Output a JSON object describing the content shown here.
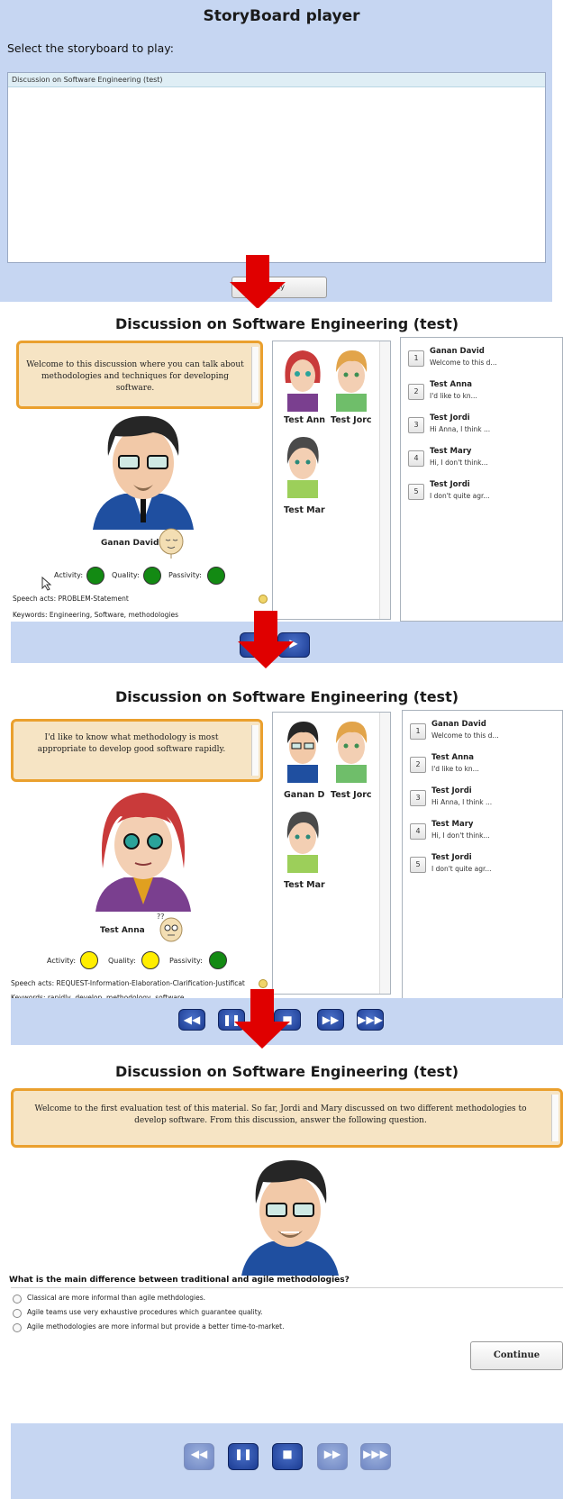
{
  "panel1": {
    "title": "StoryBoard player",
    "prompt": "Select the storyboard to play:",
    "list_items": [
      "Discussion on Software Engineering (test)"
    ],
    "play_label": "lay"
  },
  "panel2": {
    "title": "Discussion on Software Engineering (test)",
    "bubble": "Welcome to this discussion where you can talk about methodologies and techniques for developing software.",
    "speaker": "Ganan David",
    "cast": [
      "Test Ann",
      "Test Jorc",
      "Test Mar"
    ],
    "activity_label": "Activity:",
    "quality_label": "Quality:",
    "passivity_label": "Passivity:",
    "speech_acts": "Speech acts: PROBLEM-Statement",
    "keywords": "Keywords: Engineering, Software, methodologies",
    "indicator_colors": [
      "#138a13",
      "#138a13",
      "#138a13"
    ]
  },
  "transcript": [
    {
      "num": "1",
      "name": "Ganan David",
      "text": "Welcome to this d..."
    },
    {
      "num": "2",
      "name": "Test Anna",
      "text": "I'd like to kn..."
    },
    {
      "num": "3",
      "name": "Test Jordi",
      "text": "Hi Anna, I think ..."
    },
    {
      "num": "4",
      "name": "Test Mary",
      "text": "Hi, I don't think..."
    },
    {
      "num": "5",
      "name": "Test Jordi",
      "text": "I don't quite agr..."
    }
  ],
  "panel3": {
    "title": "Discussion on Software Engineering (test)",
    "bubble": "I'd like to know what methodology is most appropriate to develop good software rapidly.",
    "speaker": "Test Anna",
    "cast": [
      "Ganan D",
      "Test Jorc",
      "Test Mar"
    ],
    "activity_label": "Activity:",
    "quality_label": "Quality:",
    "passivity_label": "Passivity:",
    "speech_acts": "Speech acts: REQUEST-Information-Elaboration-Clarification-Justificat",
    "keywords": "Keywords: rapidly, develop, methodology, software",
    "indicator_colors": [
      "#ffee00",
      "#ffee00",
      "#138a13"
    ]
  },
  "panel4": {
    "title": "Discussion on Software Engineering (test)",
    "bubble": "Welcome to the first evaluation test of this material. So far, Jordi and Mary discussed on two different methodologies to develop software. From this discussion, answer the following question.",
    "question": "What is the main difference between traditional and agile methodologies?",
    "options": [
      "Classical are more informal than agile methdologies.",
      "Agile teams use very exhaustive procedures which guarantee quality.",
      "Agile methodologies are more informal but provide a better time-to-market."
    ],
    "continue_label": "Continue"
  },
  "colors": {
    "bar": "#c6d6f2",
    "bubble_border": "#eaa02e",
    "bubble_bg": "#f6e4c4",
    "arrow": "#e00000",
    "control": "#1b3b92"
  },
  "icons": [
    "rewind-icon",
    "pause-icon",
    "stop-icon",
    "fast-forward-icon",
    "skip-end-icon",
    "scroll-arrow-icon",
    "emoticon-icon"
  ]
}
